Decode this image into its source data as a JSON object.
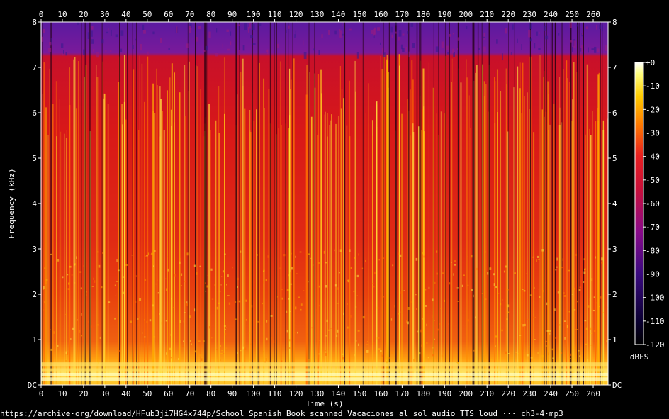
{
  "source_url": "https://archive·org/download/HFub3ji7HG4x744p/School Spanish Book scanned Vacaciones_al_sol audio TTS loud ··· ch3-4·mp3",
  "chart_data": {
    "type": "heatmap",
    "xlabel": "Time (s)",
    "ylabel": "Frequency (kHz)",
    "xlim": [
      0,
      267
    ],
    "ylim": [
      0,
      8
    ],
    "x_ticks": [
      "0",
      "10",
      "20",
      "30",
      "40",
      "50",
      "60",
      "70",
      "80",
      "90",
      "100",
      "110",
      "120",
      "130",
      "140",
      "150",
      "160",
      "170",
      "180",
      "190",
      "200",
      "210",
      "220",
      "230",
      "240",
      "250",
      "260"
    ],
    "y_ticks": [
      "DC",
      "1",
      "2",
      "3",
      "4",
      "5",
      "6",
      "7",
      "8"
    ],
    "colorbar": {
      "label": "dBFS",
      "range": [
        -120,
        0
      ],
      "ticks": [
        "+0",
        "-10",
        "-20",
        "-30",
        "-40",
        "-50",
        "-60",
        "-70",
        "-80",
        "-90",
        "-100",
        "-110",
        "-120"
      ]
    },
    "bands": [
      {
        "f_min": 7.3,
        "f_max": 8.0,
        "level_dbfs": -80
      },
      {
        "f_min": 3.0,
        "f_max": 7.3,
        "level_dbfs": -50
      },
      {
        "f_min": 0.9,
        "f_max": 3.0,
        "level_dbfs": -45
      },
      {
        "f_min": 0.5,
        "f_max": 0.9,
        "level_dbfs": -35
      },
      {
        "f_min": 0.0,
        "f_max": 0.5,
        "level_dbfs": -15
      }
    ]
  }
}
